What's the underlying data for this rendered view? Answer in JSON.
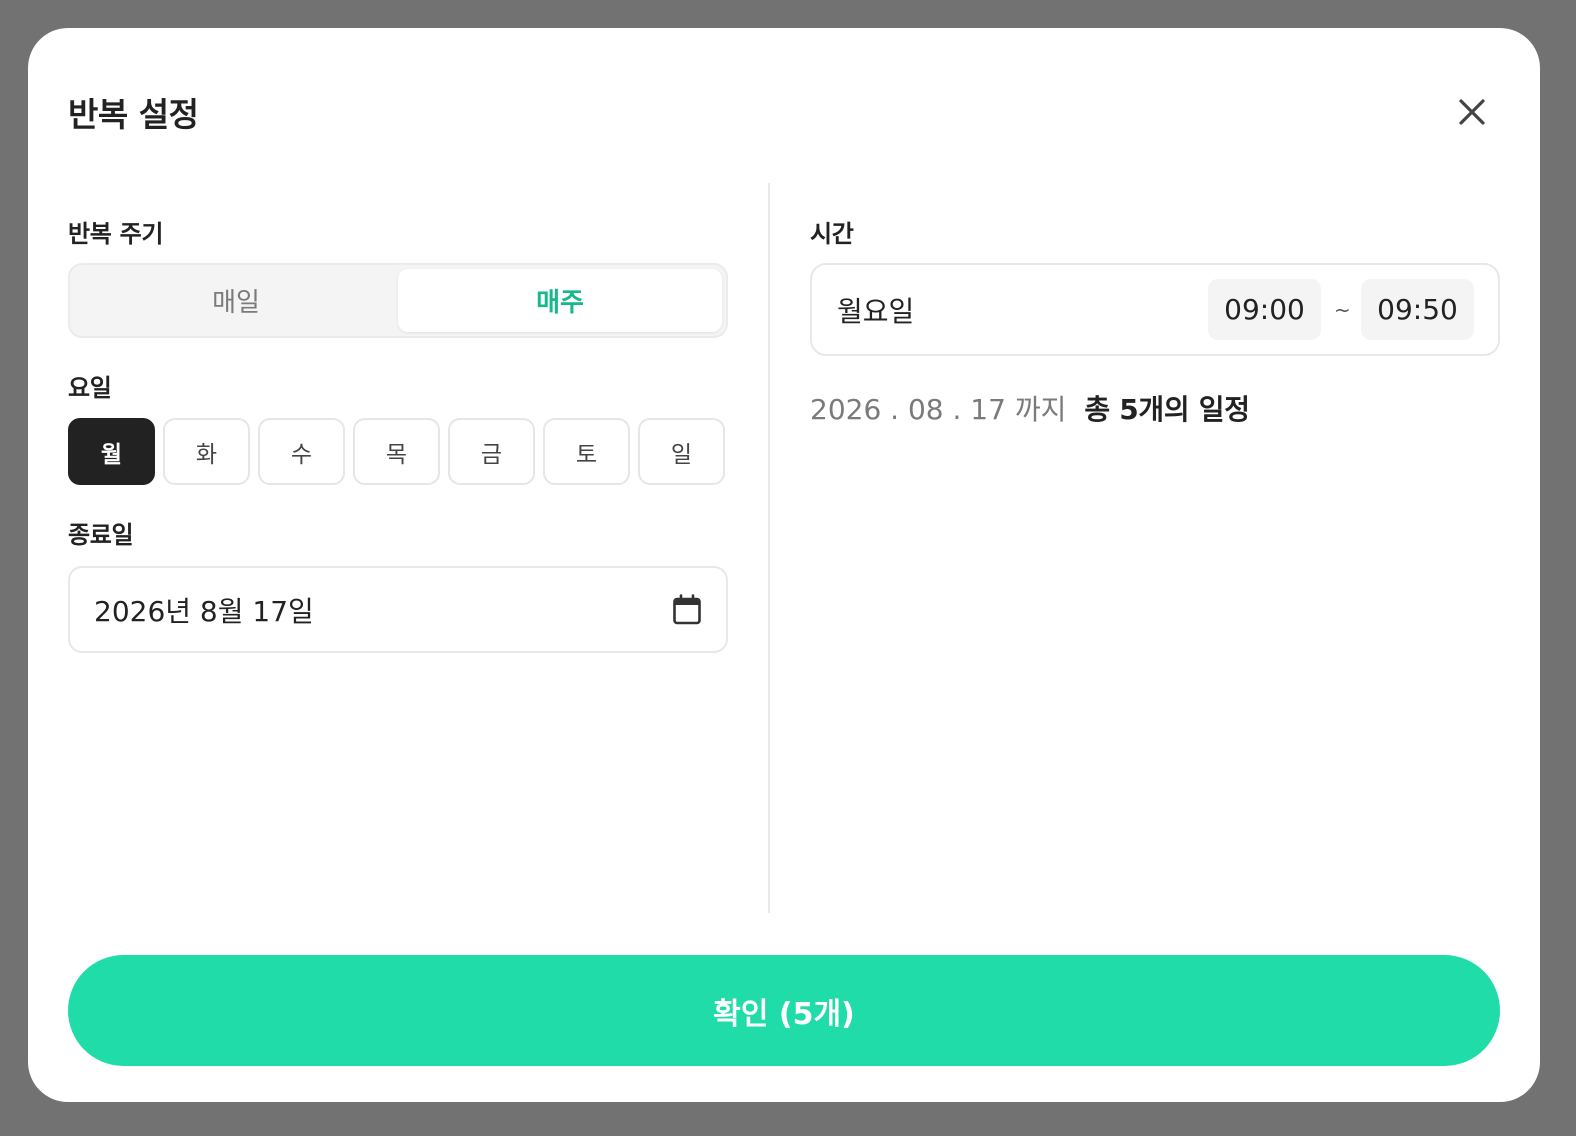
{
  "dialog": {
    "title": "반복 설정",
    "close_icon": "close-icon"
  },
  "repeat": {
    "label": "반복 주기",
    "options": [
      {
        "label": "매일",
        "selected": false
      },
      {
        "label": "매주",
        "selected": true
      }
    ]
  },
  "weekdays": {
    "label": "요일",
    "items": [
      {
        "label": "월",
        "selected": true
      },
      {
        "label": "화",
        "selected": false
      },
      {
        "label": "수",
        "selected": false
      },
      {
        "label": "목",
        "selected": false
      },
      {
        "label": "금",
        "selected": false
      },
      {
        "label": "토",
        "selected": false
      },
      {
        "label": "일",
        "selected": false
      }
    ]
  },
  "end_date": {
    "label": "종료일",
    "value": "2026년 8월 17일",
    "icon": "calendar-icon"
  },
  "time": {
    "label": "시간",
    "rows": [
      {
        "weekday": "월요일",
        "start": "09:00",
        "separator": "~",
        "end": "09:50"
      }
    ]
  },
  "summary": {
    "until": "2026 . 08 . 17 까지",
    "total": "총 5개의 일정"
  },
  "confirm_button": {
    "label": "확인 (5개)"
  },
  "colors": {
    "accent": "#20dca9",
    "accent_text": "#17b88a",
    "selected_day": "#222222",
    "overlay": "#727272"
  }
}
